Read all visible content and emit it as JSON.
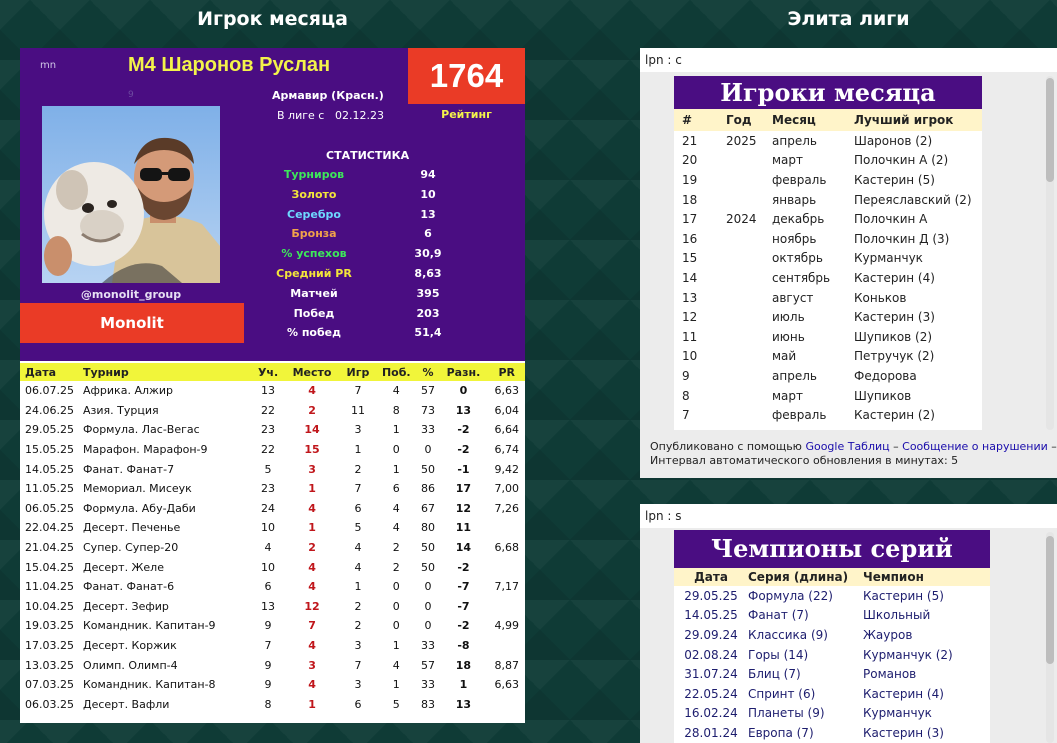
{
  "headings": {
    "left": "Игрок месяца",
    "right": "Элита лиги"
  },
  "player": {
    "mn": "mn",
    "name": "М4 Шаронов Руслан",
    "rating": "1764",
    "rating_label": "Рейтинг",
    "city": "Армавир (Красн.)",
    "since_label": "В лиге с",
    "since_date": "02.12.23",
    "small_number": "9",
    "group_tag": "@monolit_group",
    "team": "Monolit"
  },
  "stats": {
    "title": "СТАТИСТИКА",
    "rows": [
      {
        "label": "Турниров",
        "value": "94",
        "color": "#3de85a"
      },
      {
        "label": "Золото",
        "value": "10",
        "color": "#f3e53a"
      },
      {
        "label": "Серебро",
        "value": "13",
        "color": "#6ed8ff"
      },
      {
        "label": "Бронза",
        "value": "6",
        "color": "#f0a24a"
      },
      {
        "label": "% успехов",
        "value": "30,9",
        "color": "#3de85a"
      },
      {
        "label": "Средний PR",
        "value": "8,63",
        "color": "#f3e53a"
      },
      {
        "label": "Матчей",
        "value": "395",
        "color": "#ffffff"
      },
      {
        "label": "Побед",
        "value": "203",
        "color": "#ffffff"
      },
      {
        "label": "% побед",
        "value": "51,4",
        "color": "#ffffff"
      }
    ]
  },
  "tournaments": {
    "headers": [
      "Дата",
      "Турнир",
      "Уч.",
      "Место",
      "Игр",
      "Поб.",
      "%",
      "Разн.",
      "PR"
    ],
    "rows": [
      [
        "06.07.25",
        "Африка. Алжир",
        "13",
        "4",
        "7",
        "4",
        "57",
        "0",
        "6,63"
      ],
      [
        "24.06.25",
        "Азия. Турция",
        "22",
        "2",
        "11",
        "8",
        "73",
        "13",
        "6,04"
      ],
      [
        "29.05.25",
        "Формула. Лас-Вегас",
        "23",
        "14",
        "3",
        "1",
        "33",
        "-2",
        "6,64"
      ],
      [
        "15.05.25",
        "Марафон. Марафон-9",
        "22",
        "15",
        "1",
        "0",
        "0",
        "-2",
        "6,74"
      ],
      [
        "14.05.25",
        "Фанат. Фанат-7",
        "5",
        "3",
        "2",
        "1",
        "50",
        "-1",
        "9,42"
      ],
      [
        "11.05.25",
        "Мемориал. Мисеук",
        "23",
        "1",
        "7",
        "6",
        "86",
        "17",
        "7,00"
      ],
      [
        "06.05.25",
        "Формула. Абу-Даби",
        "24",
        "4",
        "6",
        "4",
        "67",
        "12",
        "7,26"
      ],
      [
        "22.04.25",
        "Десерт. Печенье",
        "10",
        "1",
        "5",
        "4",
        "80",
        "11",
        ""
      ],
      [
        "21.04.25",
        "Супер. Супер-20",
        "4",
        "2",
        "4",
        "2",
        "50",
        "14",
        "6,68"
      ],
      [
        "15.04.25",
        "Десерт. Желе",
        "10",
        "4",
        "4",
        "2",
        "50",
        "-2",
        ""
      ],
      [
        "11.04.25",
        "Фанат. Фанат-6",
        "6",
        "4",
        "1",
        "0",
        "0",
        "-7",
        "7,17"
      ],
      [
        "10.04.25",
        "Десерт. Зефир",
        "13",
        "12",
        "2",
        "0",
        "0",
        "-7",
        ""
      ],
      [
        "19.03.25",
        "Командник. Капитан-9",
        "9",
        "7",
        "2",
        "0",
        "0",
        "-2",
        "4,99"
      ],
      [
        "17.03.25",
        "Десерт. Коржик",
        "7",
        "4",
        "3",
        "1",
        "33",
        "-8",
        ""
      ],
      [
        "13.03.25",
        "Олимп. Олимп-4",
        "9",
        "3",
        "7",
        "4",
        "57",
        "18",
        "8,87"
      ],
      [
        "07.03.25",
        "Командник. Капитан-8",
        "9",
        "4",
        "3",
        "1",
        "33",
        "1",
        "6,63"
      ],
      [
        "06.03.25",
        "Десерт. Вафли",
        "8",
        "1",
        "6",
        "5",
        "83",
        "13",
        ""
      ]
    ]
  },
  "players_of_month": {
    "frame_title": "lpn : c",
    "banner": "Игроки месяца",
    "headers": [
      "#",
      "Год",
      "Месяц",
      "Лучший игрок"
    ],
    "rows": [
      [
        "21",
        "2025",
        "апрель",
        "Шаронов (2)"
      ],
      [
        "20",
        "",
        "март",
        "Полочкин А (2)"
      ],
      [
        "19",
        "",
        "февраль",
        "Кастерин (5)"
      ],
      [
        "18",
        "",
        "январь",
        "Переяславский (2)"
      ],
      [
        "17",
        "2024",
        "декабрь",
        "Полочкин А"
      ],
      [
        "16",
        "",
        "ноябрь",
        "Полочкин Д (3)"
      ],
      [
        "15",
        "",
        "октябрь",
        "Курманчук"
      ],
      [
        "14",
        "",
        "сентябрь",
        "Кастерин (4)"
      ],
      [
        "13",
        "",
        "август",
        "Коньков"
      ],
      [
        "12",
        "",
        "июль",
        "Кастерин (3)"
      ],
      [
        "11",
        "",
        "июнь",
        "Шупиков (2)"
      ],
      [
        "10",
        "",
        "май",
        "Петручук (2)"
      ],
      [
        "9",
        "",
        "апрель",
        "Федорова"
      ],
      [
        "8",
        "",
        "март",
        "Шупиков"
      ],
      [
        "7",
        "",
        "февраль",
        "Кастерин (2)"
      ]
    ],
    "footer_published": "Опубликовано с помощью",
    "footer_link1": "Google Таблиц",
    "footer_sep": "–",
    "footer_link2": "Сообщение о нарушении",
    "footer_sep2": "–",
    "footer_interval": "Интервал автоматического обновления в минутах: 5"
  },
  "series_champions": {
    "frame_title": "lpn : s",
    "banner": "Чемпионы серий",
    "headers": [
      "Дата",
      "Серия (длина)",
      "Чемпион"
    ],
    "rows": [
      [
        "29.05.25",
        "Формула (22)",
        "Кастерин (5)"
      ],
      [
        "14.05.25",
        "Фанат (7)",
        "Школьный"
      ],
      [
        "29.09.24",
        "Классика (9)",
        "Жауров"
      ],
      [
        "02.08.24",
        "Горы (14)",
        "Курманчук (2)"
      ],
      [
        "31.07.24",
        "Блиц (7)",
        "Романов"
      ],
      [
        "22.05.24",
        "Спринт (6)",
        "Кастерин (4)"
      ],
      [
        "16.02.24",
        "Планеты (9)",
        "Курманчук"
      ],
      [
        "28.01.24",
        "Европа (7)",
        "Кастерин (3)"
      ]
    ]
  }
}
